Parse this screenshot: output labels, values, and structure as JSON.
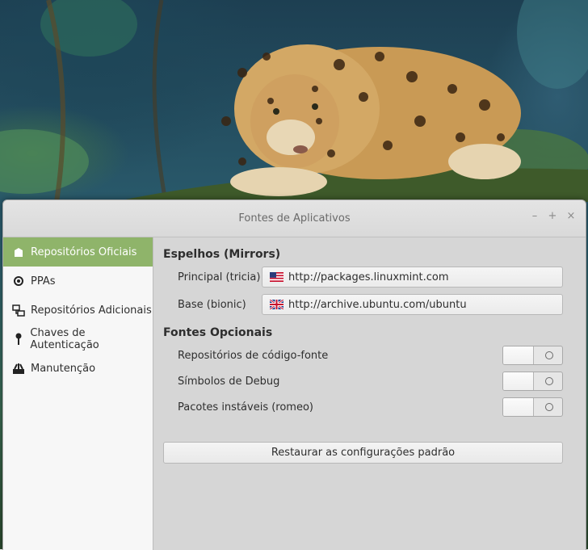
{
  "window": {
    "title": "Fontes de Aplicativos"
  },
  "window_controls": {
    "minimize": "–",
    "maximize": "+",
    "close": "×"
  },
  "sidebar": {
    "items": [
      {
        "label": "Repositórios Oficiais",
        "icon": "package-icon",
        "active": true
      },
      {
        "label": "PPAs",
        "icon": "ppa-circle-icon"
      },
      {
        "label": "Repositórios Adicionais",
        "icon": "network-icon"
      },
      {
        "label": "Chaves de Autenticação",
        "icon": "key-icon"
      },
      {
        "label": "Manutenção",
        "icon": "tools-icon"
      }
    ]
  },
  "mirrors": {
    "heading": "Espelhos (Mirrors)",
    "main": {
      "label": "Principal (tricia)",
      "url": "http://packages.linuxmint.com",
      "flag": "us-flag-icon"
    },
    "base": {
      "label": "Base (bionic)",
      "url": "http://archive.ubuntu.com/ubuntu",
      "flag": "uk-flag-icon"
    }
  },
  "optional": {
    "heading": "Fontes Opcionais",
    "items": [
      {
        "label": "Repositórios de código-fonte",
        "enabled": false
      },
      {
        "label": "Símbolos de Debug",
        "enabled": false
      },
      {
        "label": "Pacotes instáveis (romeo)",
        "enabled": false
      }
    ]
  },
  "restore_button": "Restaurar as configurações padrão",
  "colors": {
    "accent": "#8fb46a",
    "window_bg": "#d6d6d6",
    "sidebar_bg": "#f7f7f7"
  }
}
